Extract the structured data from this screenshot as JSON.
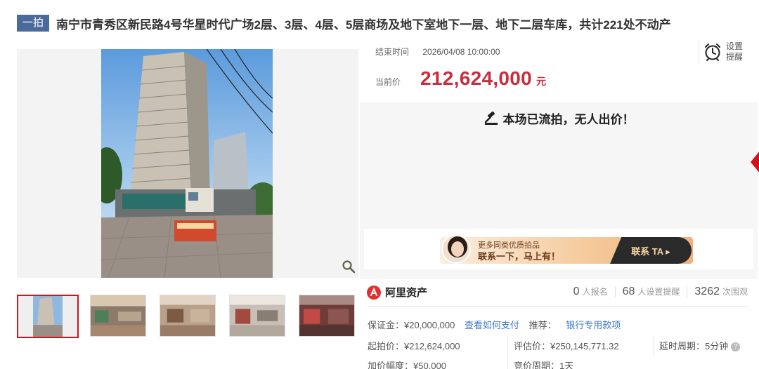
{
  "header": {
    "round_tag": "一拍",
    "title": "南宁市青秀区新民路4号华星时代广场2层、3层、4层、5层商场及地下室地下一层、地下二层车库，共计221处不动产"
  },
  "auction": {
    "end_time_label": "结束时间",
    "end_time_value": "2026/04/08 10:00:00",
    "reminder_label_line1": "设置",
    "reminder_label_line2": "提醒",
    "current_price_label": "当前价",
    "current_price_value": "212,624,000",
    "current_price_unit": "元",
    "status_message": "本场已流拍，无人出价！"
  },
  "banner": {
    "subtitle": "更多同类优质拍品",
    "title": "联系一下，马上有！",
    "button_label": "联系 TA ▸"
  },
  "stats": {
    "brand_name": "阿里资产",
    "signups_count": "0",
    "signups_label": "人报名",
    "reminders_count": "68",
    "reminders_label": "人设置提醒",
    "views_count": "3262",
    "views_label": "次围观"
  },
  "details": {
    "deposit": "保证金：¥20,000,000",
    "payment_link": "查看如何支付",
    "recommend_label": "推荐：",
    "recommend_link": "银行专用款项",
    "start_price": "起拍价：¥212,624,000",
    "appraisal": "评估价：¥250,145,771.32",
    "delay_period": "延时周期：5分钟",
    "increment": "加价幅度：¥50,000",
    "bid_period": "竞价周期：1天"
  },
  "colors": {
    "accent_red": "#c72e3e",
    "tag_blue": "#4a6a9a",
    "link_blue": "#3a76c7"
  }
}
